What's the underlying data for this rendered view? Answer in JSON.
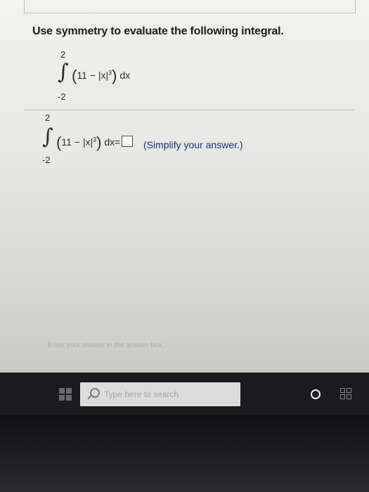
{
  "question": {
    "prompt": "Use symmetry to evaluate the following integral."
  },
  "integral_display": {
    "upper": "2",
    "lower": "-2",
    "sign": "∫",
    "open_paren": "(",
    "integrand_text": "11 − |x|",
    "exponent": "3",
    "close_paren": ")",
    "differential": "dx"
  },
  "answer_row": {
    "upper": "2",
    "lower": "-2",
    "sign": "∫",
    "open_paren": "(",
    "integrand_text": "11 − |x|",
    "exponent": "3",
    "close_paren": ")",
    "differential": "dx",
    "equals": "=",
    "hint": "(Simplify your answer.)"
  },
  "status": {
    "message": "Enter your answer in the answer box."
  },
  "taskbar": {
    "search_placeholder": "Type here to search"
  }
}
